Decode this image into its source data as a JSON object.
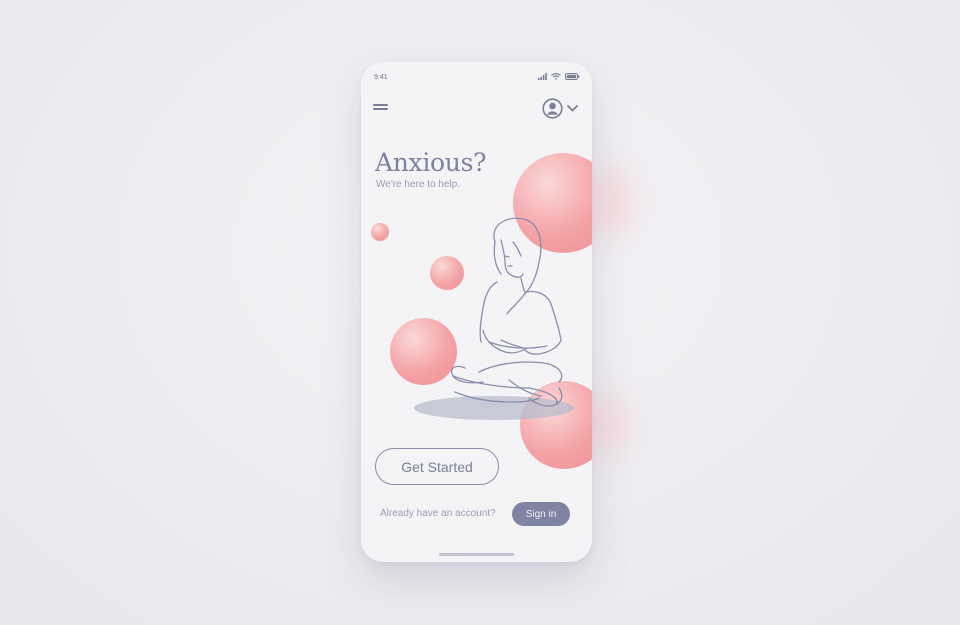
{
  "status_bar": {
    "time": "9:41",
    "icons": [
      "signal-icon",
      "wifi-icon",
      "battery-icon"
    ]
  },
  "header": {
    "menu_icon": "hamburger-menu-icon",
    "profile_icon": "user-avatar-icon",
    "dropdown_icon": "chevron-down-icon"
  },
  "hero": {
    "title": "Anxious?",
    "subtitle": "We're here to help.",
    "illustration": "meditating-woman-illustration"
  },
  "actions": {
    "get_started_label": "Get Started",
    "account_prompt": "Already have an account?",
    "sign_in_label": "Sign in"
  },
  "colors": {
    "accent_pink": "#f4a3a6",
    "primary_slate": "#7f84a3",
    "text_muted": "#9a9cb5",
    "background": "#f4f4f7"
  }
}
